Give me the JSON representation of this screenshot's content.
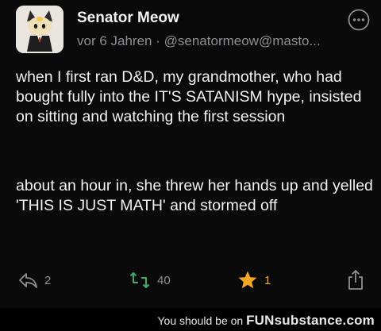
{
  "post": {
    "author_name": "Senator Meow",
    "timestamp": "vor 6 Jahren",
    "separator": "·",
    "handle": "@senatormeow@masto...",
    "paragraphs": [
      "when I first ran D&D, my grandmother, who had bought fully into the IT'S SATANISM hype, insisted on sitting and watching the first session",
      "about an hour in, she threw her hands up and yelled 'THIS IS JUST MATH' and stormed off"
    ],
    "actions": {
      "reply_count": "2",
      "boost_count": "40",
      "favourite_count": "1"
    }
  },
  "footer": {
    "prefix": "You should be on",
    "brand": "FUNsubstance.com"
  },
  "colors": {
    "background": "#000000",
    "text": "#f2f2f2",
    "muted": "#8e8e93",
    "boost_green": "#3fae6a",
    "star_gold": "#f5a623"
  },
  "icons": {
    "more": "ellipsis-circle-icon",
    "reply": "reply-arrow-icon",
    "boost": "boost-retweet-icon",
    "favourite": "star-icon",
    "share": "share-icon"
  }
}
